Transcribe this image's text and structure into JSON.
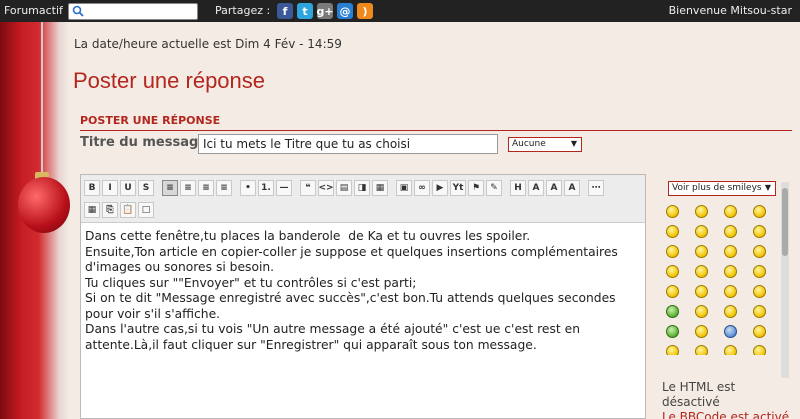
{
  "topbar": {
    "brand": "Forumactif",
    "share_label": "Partagez :",
    "welcome": "Bienvenue Mitsou-star",
    "share_icons": [
      {
        "name": "facebook-icon",
        "glyph": "f",
        "color": "#3b5998"
      },
      {
        "name": "twitter-icon",
        "glyph": "t",
        "color": "#2fa5e0"
      },
      {
        "name": "google-plus-icon",
        "glyph": "g+",
        "color": "#7a7a7a"
      },
      {
        "name": "email-icon",
        "glyph": "@",
        "color": "#2a7fd4"
      },
      {
        "name": "rss-icon",
        "glyph": ")",
        "color": "#ee8a1c"
      }
    ]
  },
  "main": {
    "datetime": "La date/heure actuelle est Dim 4 Fév - 14:59",
    "page_title": "Poster une réponse",
    "section_head": "POSTER UNE RÉPONSE",
    "msg_title_label": "Titre du message",
    "msg_title_value": "Ici tu mets le Titre que tu as choisi",
    "icon_select": "Aucune"
  },
  "editor": {
    "toolbar_row1": [
      "B",
      "I",
      "U",
      "S",
      "|",
      "al",
      "ac",
      "ar",
      "aj",
      "|",
      "ul",
      "ol",
      "hr",
      "|",
      "q",
      "cd",
      "sp",
      "hd",
      "tb",
      "|",
      "im",
      "ln",
      "vi",
      "yt",
      "fl",
      "ex",
      "|",
      "H",
      "A",
      "sz",
      "fn",
      "|",
      "more"
    ],
    "toolbar_row2": [
      "dt",
      "cp",
      "pa",
      "nw"
    ],
    "text": "Dans cette fenêtre,tu places la banderole  de Ka et tu ouvres les spoiler.\nEnsuite,Ton article en copier-coller je suppose et quelques insertions complémentaires d'images ou sonores si besoin.\nTu cliques sur \"\"Envoyer\" et tu contrôles si c'est parti;\nSi on te dit \"Message enregistré avec succès\",c'est bon.Tu attends quelques secondes pour voir s'il s'affiche.\nDans l'autre cas,si tu vois \"Un autre message a été ajouté\" c'est ue c'est rest en attente.Là,il faut cliquer sur \"Enregistrer\" qui apparaît sous ton message."
  },
  "smileys": {
    "select_label": "Voir plus de smileys",
    "html_note": "Le HTML est désactivé",
    "bbcode_note": "Le BBCode est activé"
  },
  "colors": {
    "accent": "#b3261e",
    "background": "#f4ece4",
    "topbar": "#222222"
  }
}
